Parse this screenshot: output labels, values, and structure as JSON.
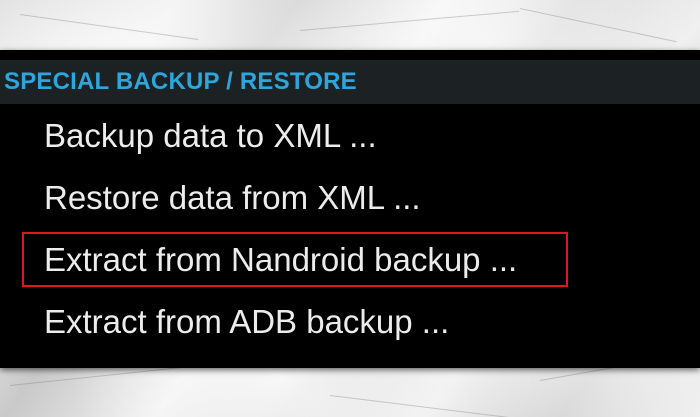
{
  "menu": {
    "header": "SPECIAL BACKUP / RESTORE",
    "items": [
      {
        "label": "Backup data to XML ..."
      },
      {
        "label": "Restore data from XML ..."
      },
      {
        "label": "Extract from Nandroid backup ..."
      },
      {
        "label": "Extract from ADB backup ..."
      }
    ],
    "highlighted_index": 2
  },
  "colors": {
    "header_text": "#2ea6dc",
    "header_bg": "#1c2124",
    "panel_bg": "#000000",
    "item_text": "#ececec",
    "highlight_border": "#e0161b"
  }
}
